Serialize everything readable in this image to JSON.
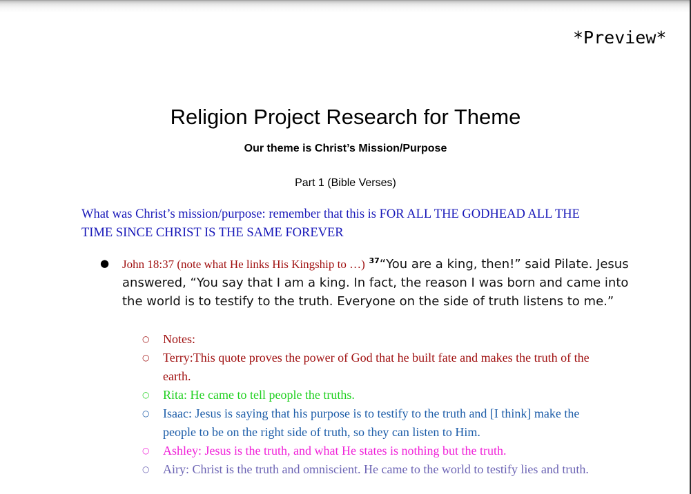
{
  "preview_label": "*Preview*",
  "document": {
    "title": "Religion Project Research for Theme",
    "subtitle": "Our theme is Christ’s Mission/Purpose",
    "part": "Part 1 (Bible Verses)",
    "intro": "What was Christ’s mission/purpose: remember that this is FOR ALL THE GODHEAD ALL THE TIME SINCE CHRIST IS THE SAME FOREVER",
    "bullet_glyph": "●",
    "item": {
      "reference": "John 18:37 (note what He links His Kingship to …)",
      "verse_number": "37",
      "verse_text": "“You are a king, then!” said Pilate. Jesus answered, “You say that I am a king. In fact, the reason I was born and came into the world is to testify to the truth. Everyone on the side of truth listens to me.”"
    },
    "sub_bullet_glyph": "○",
    "notes": [
      {
        "text": "Notes:",
        "color": "#a01010"
      },
      {
        "text": "Terry:This quote proves the power of God that he built fate and makes the truth of the earth.",
        "color": "#a01010"
      },
      {
        "text": "Rita: He came to tell people the truths.",
        "color": "#1fd01f"
      },
      {
        "text": "Isaac: Jesus is saying that his purpose is to testify to the truth and [I think] make the people to be on the right side of truth, so they can listen to Him.",
        "color": "#1c5ca8"
      },
      {
        "text": "Ashley: Jesus is the truth, and what He states is nothing but the truth.",
        "color": "#f020d8"
      },
      {
        "text": "Airy: Christ is the truth and omniscient. He came to the world to testify lies and truth.",
        "color": "#6c64b4"
      }
    ]
  }
}
